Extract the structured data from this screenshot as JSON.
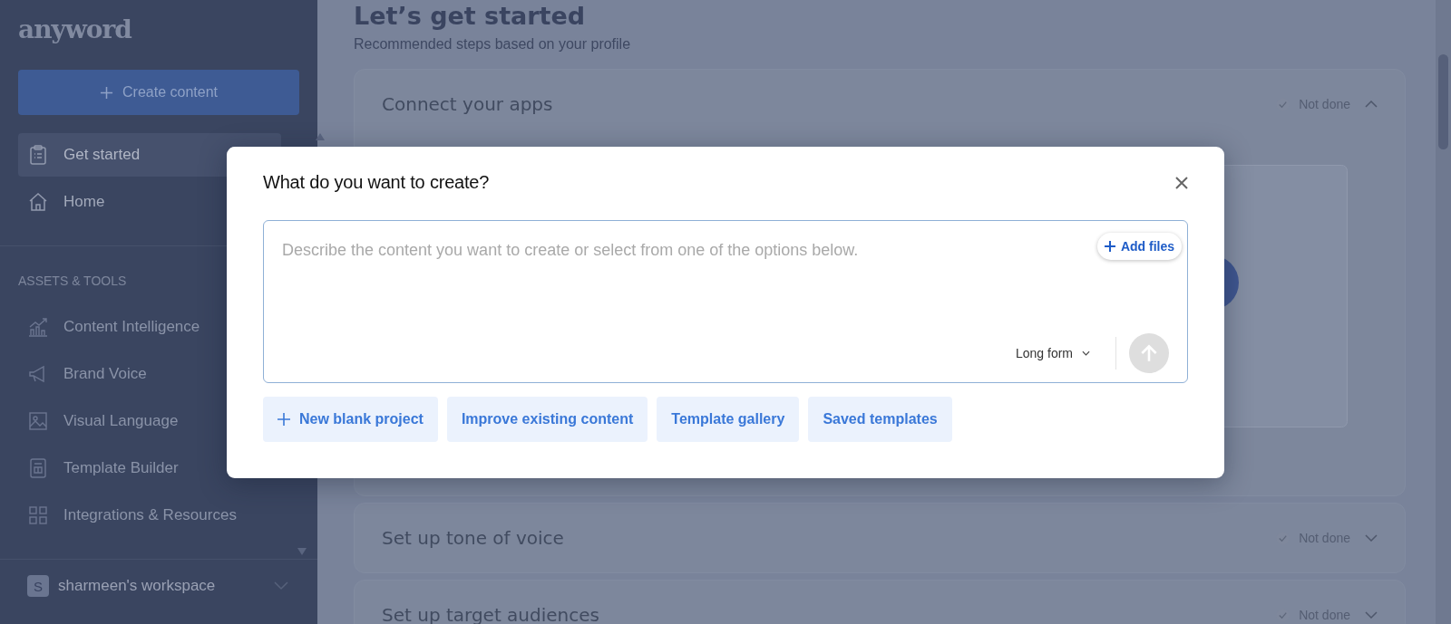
{
  "sidebar": {
    "logo": "anyword",
    "create_button": "Create content",
    "nav": [
      {
        "label": "Get started",
        "selected": true
      },
      {
        "label": "Home",
        "selected": false
      }
    ],
    "section_label": "ASSETS & TOOLS",
    "tools": [
      {
        "label": "Content Intelligence",
        "selected": false
      },
      {
        "label": "Brand Voice",
        "selected": false
      },
      {
        "label": "Visual Language",
        "selected": false
      },
      {
        "label": "Template Builder",
        "selected": false
      },
      {
        "label": "Integrations & Resources",
        "selected": false
      }
    ],
    "workspace": {
      "initial": "S",
      "name": "sharmeen's workspace"
    }
  },
  "main": {
    "title": "Let’s get started",
    "subtitle": "Recommended steps based on your profile",
    "steps": [
      {
        "title": "Connect your apps",
        "status": "Not done",
        "done": false,
        "expanded": true
      },
      {
        "title": "Set up tone of voice",
        "status": "Not done",
        "done": false,
        "expanded": false
      },
      {
        "title": "Set up target audiences",
        "status": "Not done",
        "done": false,
        "expanded": false
      }
    ]
  },
  "modal": {
    "title": "What do you want to create?",
    "placeholder": "Describe the content you want to create or select from one of the options below.",
    "add_files": "Add files",
    "format": "Long form",
    "actions": [
      {
        "label": "New blank project",
        "kind": "add"
      },
      {
        "label": "Improve existing content",
        "kind": "plain"
      },
      {
        "label": "Template gallery",
        "kind": "plain"
      },
      {
        "label": "Saved templates",
        "kind": "plain"
      }
    ]
  }
}
